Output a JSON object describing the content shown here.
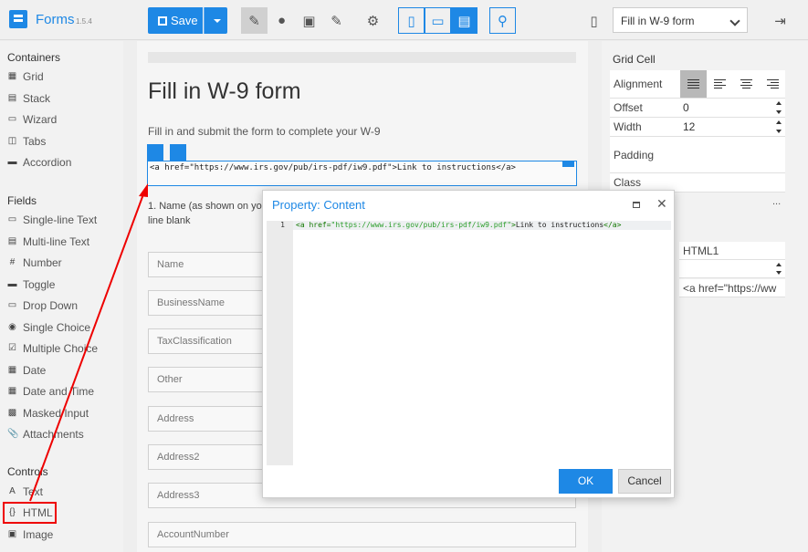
{
  "app": {
    "title": "Forms",
    "version": "1.5.4"
  },
  "toolbar": {
    "save_label": "Save",
    "page_select_value": "Fill in W-9 form"
  },
  "toolbox": {
    "categories": {
      "containers": "Containers",
      "fields": "Fields",
      "controls": "Controls"
    },
    "containers": [
      "Grid",
      "Stack",
      "Wizard",
      "Tabs",
      "Accordion"
    ],
    "fields": [
      "Single-line Text",
      "Multi-line Text",
      "Number",
      "Toggle",
      "Drop Down",
      "Single Choice",
      "Multiple Choice",
      "Date",
      "Date and Time",
      "Masked Input",
      "Attachments"
    ],
    "controls": [
      "Text",
      "HTML",
      "Image"
    ]
  },
  "form": {
    "title": "Fill in W-9 form",
    "description": "Fill in and submit the form to complete your W-9",
    "html_content": "<a href=\"https://www.irs.gov/pub/irs-pdf/iw9.pdf\">Link to instructions</a>",
    "question_label": "1. Name (as shown on yo",
    "question_label_2": "line blank",
    "fields": [
      "Name",
      "BusinessName",
      "TaxClassification",
      "Other",
      "Address",
      "Address2",
      "Address3",
      "AccountNumber"
    ]
  },
  "properties": {
    "title": "Grid Cell",
    "alignment_label": "Alignment",
    "offset_label": "Offset",
    "offset_value": "0",
    "width_label": "Width",
    "width_value": "12",
    "padding_label": "Padding",
    "class_label": "Class",
    "name_value": "HTML1",
    "content_value": "<a href=\"https://ww",
    "more_label": "..."
  },
  "modal": {
    "title": "Property: Content",
    "line_number": "1",
    "code": {
      "open": "<a href=",
      "url": "\"https://www.irs.gov/pub/irs-pdf/iw9.pdf\"",
      "close_open": ">",
      "text": "Link to instructions",
      "end_tag": "</a>"
    },
    "ok_label": "OK",
    "cancel_label": "Cancel"
  },
  "colors": {
    "accent": "#1e88e5",
    "highlight": "#e00000"
  }
}
